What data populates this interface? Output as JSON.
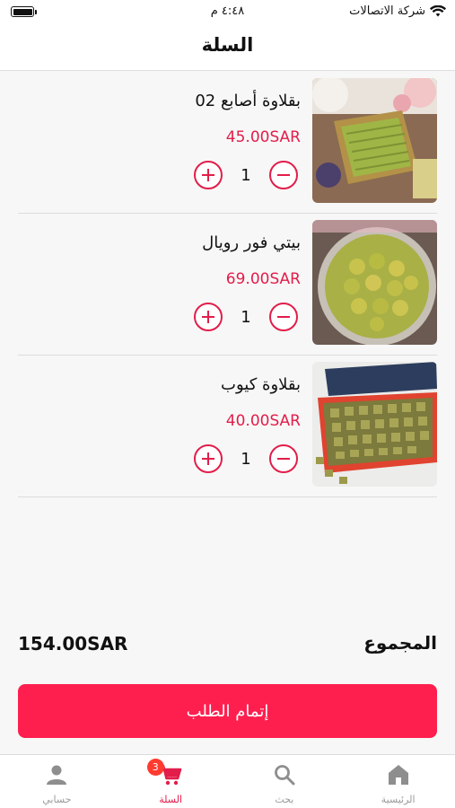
{
  "status_bar": {
    "carrier": "شركة الاتصالات",
    "time": "٤:٤٨ م"
  },
  "header": {
    "title": "السلة"
  },
  "cart": {
    "items": [
      {
        "name": "بقلاوة أصابع  02",
        "price": "45.00SAR",
        "quantity": "1"
      },
      {
        "name": "بيتي فور رويال",
        "price": "69.00SAR",
        "quantity": "1"
      },
      {
        "name": "بقلاوة كيوب",
        "price": "40.00SAR",
        "quantity": "1"
      }
    ]
  },
  "summary": {
    "total_label": "المجموع",
    "total_value": "154.00SAR"
  },
  "checkout": {
    "label": "إتمام الطلب"
  },
  "tab_bar": {
    "cart_badge": "3",
    "tabs": [
      {
        "label": "حسابي",
        "icon": "person-icon"
      },
      {
        "label": "السلة",
        "icon": "cart-icon",
        "active": true
      },
      {
        "label": "بحث",
        "icon": "search-icon"
      },
      {
        "label": "الرئيسية",
        "icon": "home-icon"
      }
    ]
  },
  "colors": {
    "accent": "#e21d4a",
    "button": "#ff1f4f",
    "inactive_tab": "#9a9a9a"
  }
}
